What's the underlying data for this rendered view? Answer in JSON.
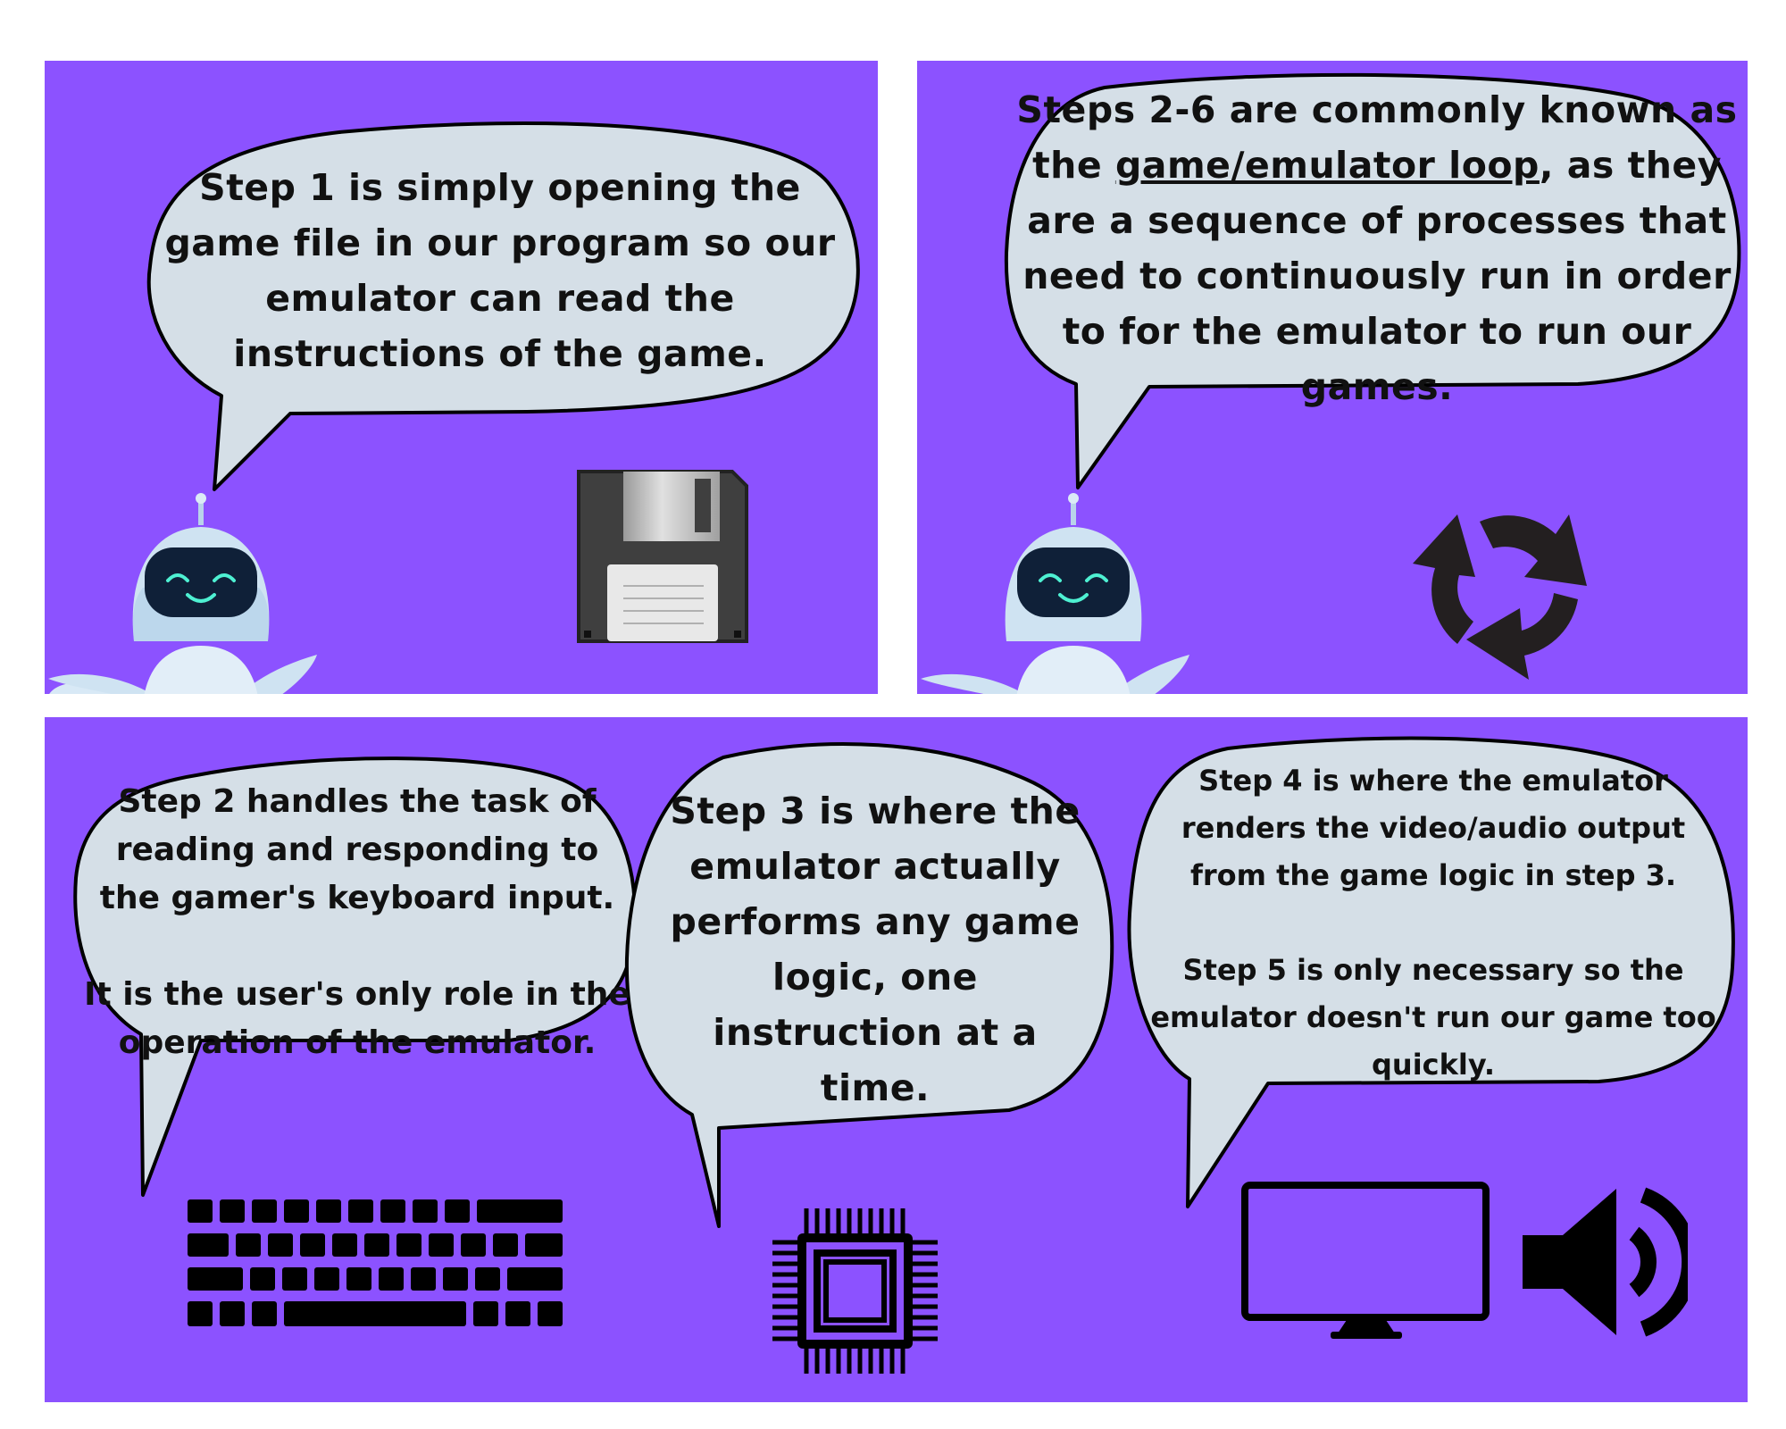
{
  "panels": {
    "step1": {
      "text": "Step 1 is simply opening the game file in our program so our emulator can read the instructions of the game.",
      "icon": "floppy-disk-icon"
    },
    "step_loop": {
      "text_before": "Steps 2-6 are commonly known as the ",
      "link": "game/emulator loop",
      "text_after": ", as they are a sequence of processes that need to continuously run in order to for the emulator to run our games.",
      "icon": "cycle-arrows-icon"
    },
    "step2": {
      "text": "Step 2 handles the task of reading and responding to the gamer's keyboard input.\n\nIt is the user's only role in the operation of the emulator.",
      "icon": "keyboard-icon"
    },
    "step3": {
      "text": "Step 3 is where the emulator actually performs any game logic, one instruction at a time.",
      "icon": "cpu-chip-icon"
    },
    "step45": {
      "text": "Step 4 is where the emulator renders the video/audio output from the game logic in step 3.\n\nStep 5 is only necessary so the emulator doesn't run our game too quickly.",
      "icons": [
        "monitor-icon",
        "speaker-icon"
      ]
    }
  },
  "colors": {
    "panel_bg": "#8c52ff",
    "bubble_fill": "#d5dfe7",
    "bubble_stroke": "#000000",
    "icon": "#231f20",
    "robot_body": "#cfe3f2",
    "robot_face": "#0f2038",
    "robot_eyes": "#4ef0d2"
  }
}
